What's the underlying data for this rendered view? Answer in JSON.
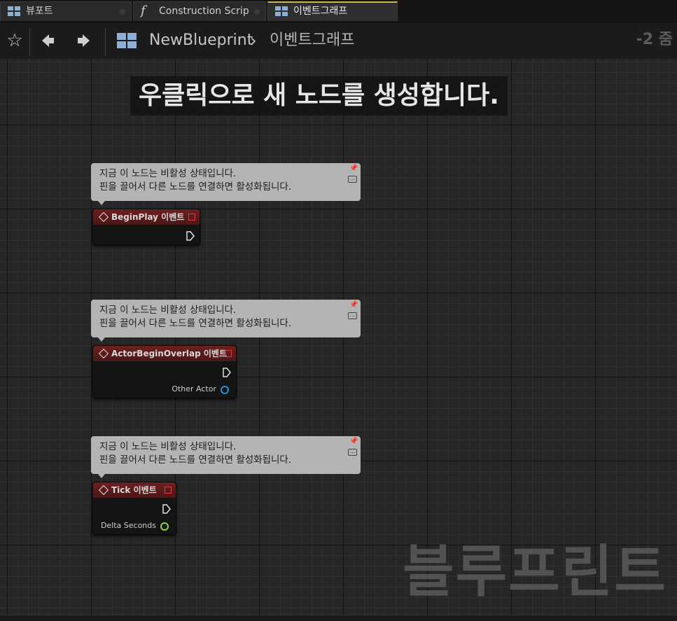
{
  "tabs": [
    {
      "label": "뷰포트",
      "icon": "viewport-icon"
    },
    {
      "label": "Construction Scrip",
      "icon": "function-icon"
    },
    {
      "label": "이벤트그래프",
      "icon": "event-graph-icon"
    }
  ],
  "toolbar": {
    "blueprint_name": "NewBlueprint",
    "separator": "›",
    "graph_name": "이벤트그래프",
    "zoom": "-2 줌"
  },
  "graph": {
    "hint": "우클릭으로 새 노드를 생성합니다.",
    "watermark": "블루프린트",
    "comment_line1": "지금 이 노드는 비활성 상태입니다.",
    "comment_line2": "핀을 끌어서 다른 노드를 연결하면 활성화됩니다.",
    "nodes": [
      {
        "title": "BeginPlay 이벤트",
        "pin": ""
      },
      {
        "title": "ActorBeginOverlap 이벤트",
        "pin": "Other Actor"
      },
      {
        "title": "Tick 이벤트",
        "pin": "Delta Seconds"
      }
    ]
  },
  "colors": {
    "event_header": "#6e1f1f",
    "object_pin": "#2b8fd6",
    "float_pin": "#8bd43a",
    "active_tab_accent": "#c9b84b"
  }
}
